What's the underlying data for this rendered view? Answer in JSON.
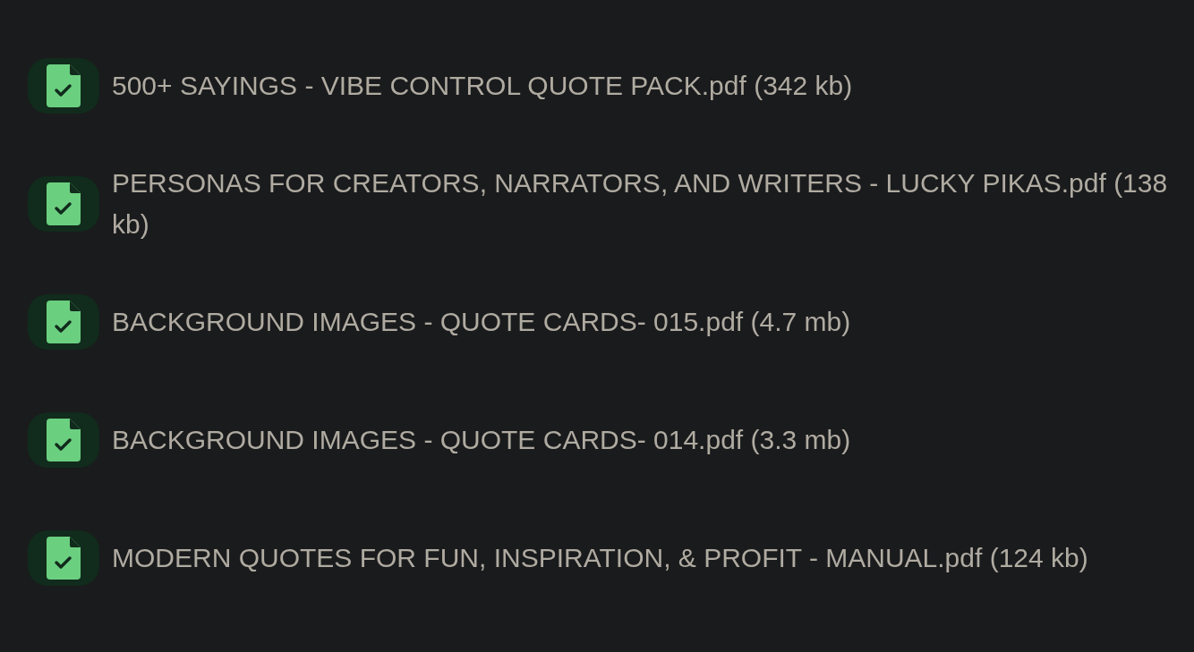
{
  "files": [
    {
      "name": "500+ SAYINGS - VIBE CONTROL QUOTE PACK.pdf (342 kb)"
    },
    {
      "name": "PERSONAS FOR CREATORS, NARRATORS, AND WRITERS - LUCKY PIKAS.pdf (138 kb)"
    },
    {
      "name": "BACKGROUND IMAGES - QUOTE CARDS- 015.pdf (4.7 mb)"
    },
    {
      "name": "BACKGROUND IMAGES - QUOTE CARDS- 014.pdf (3.3 mb)"
    },
    {
      "name": "MODERN QUOTES FOR FUN, INSPIRATION, & PROFIT - MANUAL.pdf (124 kb)"
    }
  ]
}
